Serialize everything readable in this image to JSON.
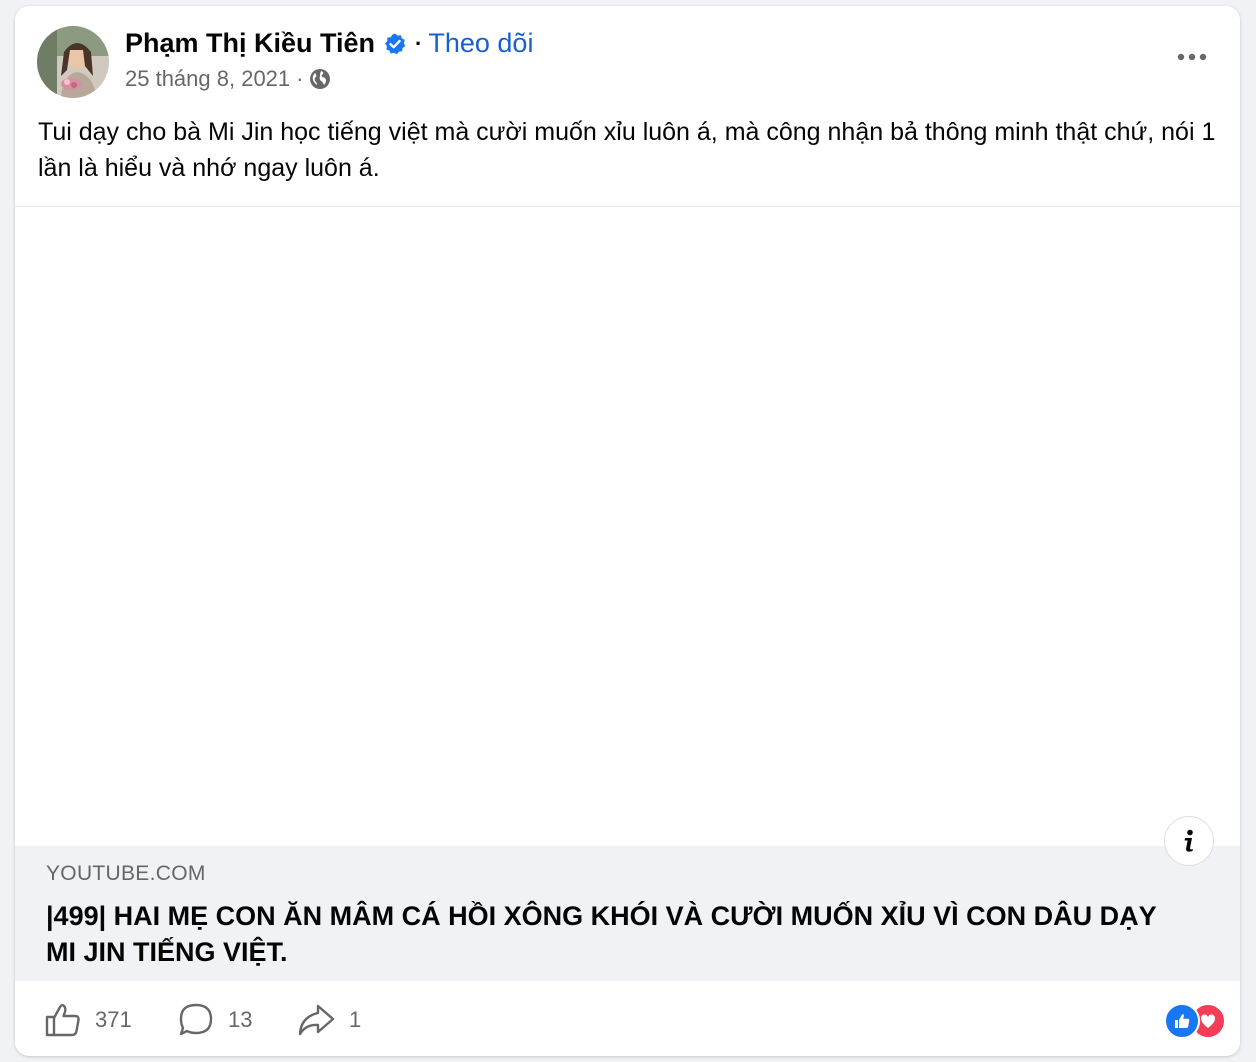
{
  "post": {
    "author_name": "Phạm Thị Kiều Tiên",
    "separator": "·",
    "follow_label": "Theo dõi",
    "date": "25 tháng 8, 2021",
    "meta_separator": "·",
    "privacy_icon": "globe-icon",
    "verified_icon": "verified-badge-icon",
    "more_icon": "more-horizontal-icon",
    "text": "Tui dạy cho bà Mi Jin học tiếng việt mà cười muốn xỉu luôn á, mà công nhận bả thông minh thật chứ, nói 1 lần là hiểu và nhớ ngay luôn á."
  },
  "link_preview": {
    "domain": "YOUTUBE.COM",
    "title": "|499| HAI MẸ CON ĂN MÂM CÁ HỒI XÔNG KHÓI VÀ CƯỜI MUỐN XỈU VÌ CON DÂU DẠY MI JIN TIẾNG VIỆT.",
    "info_icon": "info-icon"
  },
  "actions": {
    "like_count": "371",
    "comment_count": "13",
    "share_count": "1",
    "like_icon": "thumbs-up-icon",
    "comment_icon": "comment-bubble-icon",
    "share_icon": "share-arrow-icon"
  },
  "reactions": [
    "like",
    "love"
  ],
  "colors": {
    "link_blue": "#1a5fd0",
    "verified_blue": "#1877f2",
    "love_red": "#f33e58",
    "secondary_text": "#65676b",
    "preview_bg": "#f0f2f5"
  }
}
